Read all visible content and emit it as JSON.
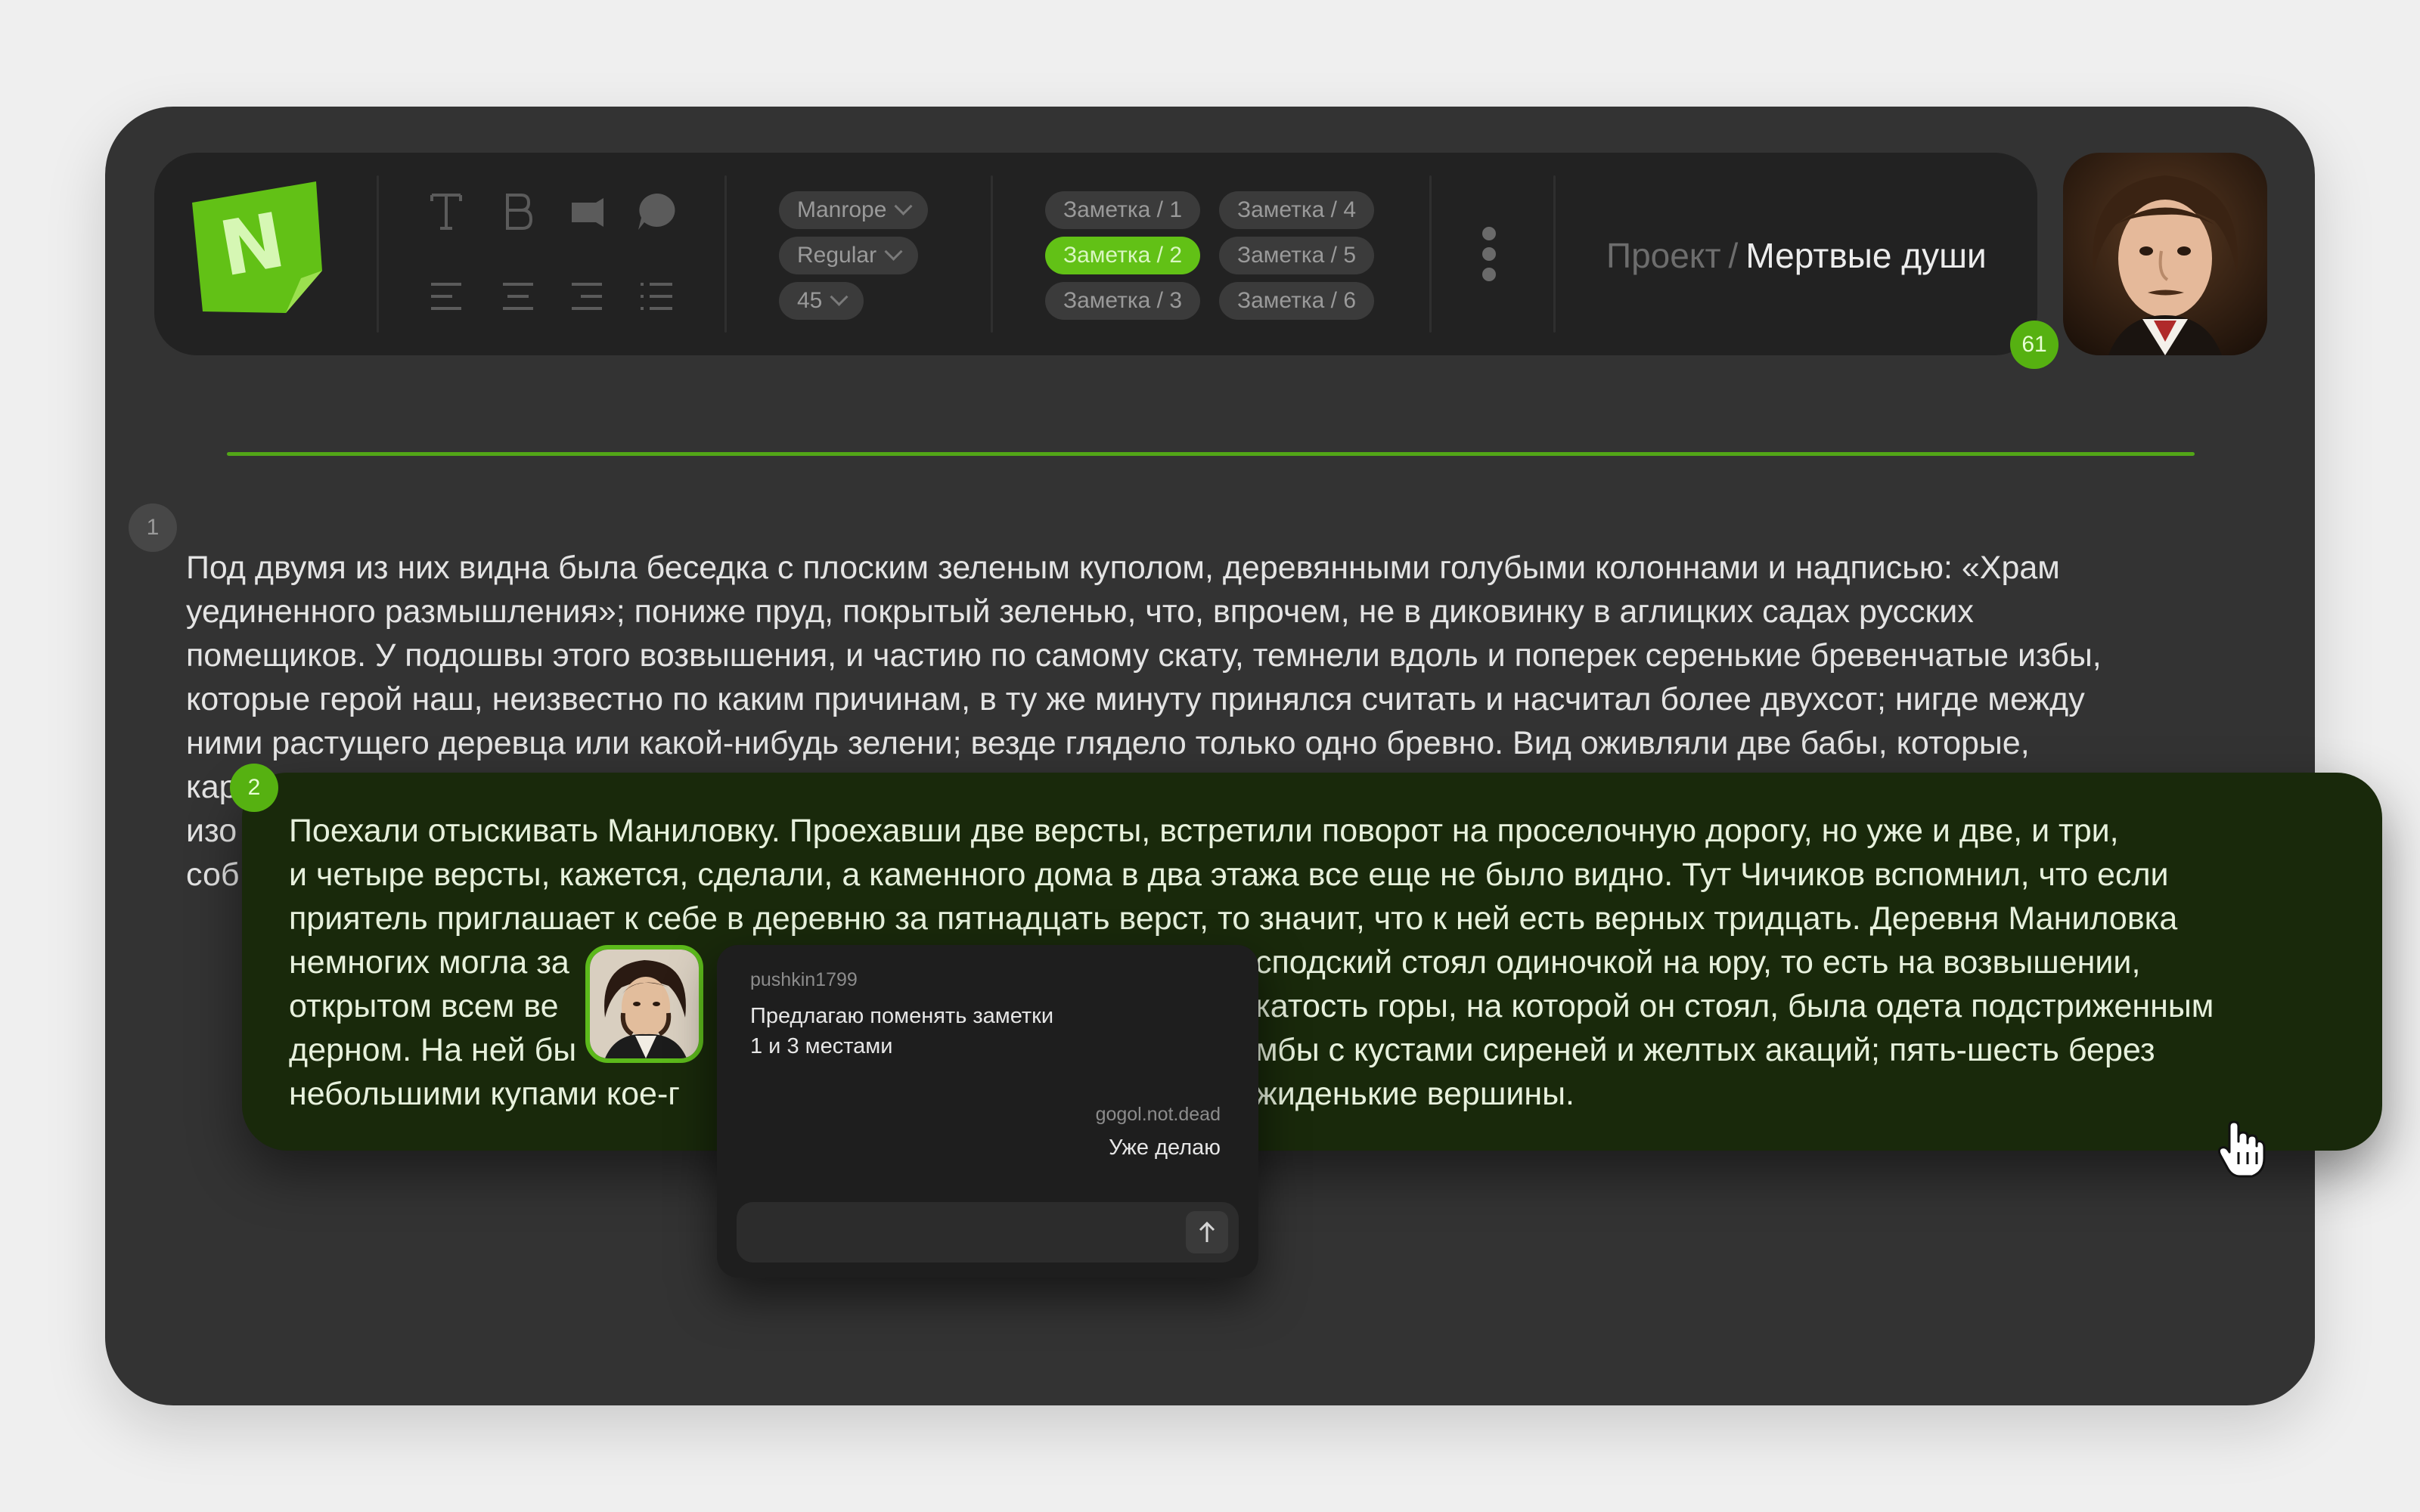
{
  "app": {
    "logo_letter": "N",
    "accent_color": "#62c116",
    "background_color": "#333333"
  },
  "toolbar": {
    "tools": [
      {
        "name": "text-tool-icon"
      },
      {
        "name": "bold-tool-icon"
      },
      {
        "name": "marker-tool-icon"
      },
      {
        "name": "comment-tool-icon"
      },
      {
        "name": "align-left-icon"
      },
      {
        "name": "align-center-icon"
      },
      {
        "name": "align-right-icon"
      },
      {
        "name": "list-icon"
      }
    ],
    "font": {
      "family": "Manrope",
      "weight": "Regular",
      "size": "45"
    },
    "notes": [
      {
        "label": "Заметка / 1",
        "active": false
      },
      {
        "label": "Заметка / 2",
        "active": true
      },
      {
        "label": "Заметка / 3",
        "active": false
      },
      {
        "label": "Заметка / 4",
        "active": false
      },
      {
        "label": "Заметка / 5",
        "active": false
      },
      {
        "label": "Заметка / 6",
        "active": false
      }
    ],
    "breadcrumb": {
      "root": "Проект",
      "separator": "/",
      "current": "Мертвые души"
    },
    "avatar_badge": "61"
  },
  "document": {
    "note1_number": "1",
    "note1_lines": [
      "Под двумя из них видна была беседка с плоским зеленым куполом, деревянными голубыми колоннами и надписью: «Храм",
      "уединенного размышления»; пониже пруд, покрытый зеленью, что, впрочем, не в диковинку в аглицких садах русских",
      "помещиков. У подошвы этого возвышения, и частию по самому скату, темнели вдоль и поперек серенькие бревенчатые избы,",
      "которые герой наш, неизвестно по каким причинам, в ту же минуту принялся считать и насчитал более двухсот; нигде между",
      "ними растущего деревца или какой-нибудь зелени; везде глядело только одно бревно. Вид оживляли две бабы, которые,",
      "кар",
      "изо",
      "соб"
    ],
    "note2_number": "2",
    "note2_lines": [
      "Поехали отыскивать Маниловку. Проехавши две версты, встретили поворот на проселочную дорогу, но уже и две, и три,",
      "и четыре версты, кажется, сделали, а каменного дома в два этажа все еще не было видно. Тут Чичиков вспомнил, что если",
      "приятель приглашает к себе в деревню за пятнадцать верст, то значит, что к ней есть верных тридцать. Деревня Маниловка",
      "немногих могла за",
      "открытом всем ве",
      "дерном. На ней бы",
      "небольшими купами кое-г"
    ],
    "note2_lines_right": [
      "сподский стоял одиночкой на юру, то есть на возвышении,",
      "катость горы, на которой он стоял, была одета подстриженным",
      "мбы с кустами сиреней и желтых акаций; пять-шесть берез",
      "жиденькие вершины."
    ]
  },
  "chat": {
    "messages": [
      {
        "user": "pushkin1799",
        "text": "Предлагаю поменять заметки 1 и 3 местами"
      },
      {
        "user": "gogol.not.dead",
        "text": "Уже делаю"
      }
    ],
    "input_value": "",
    "send_icon": "arrow-up-icon"
  }
}
